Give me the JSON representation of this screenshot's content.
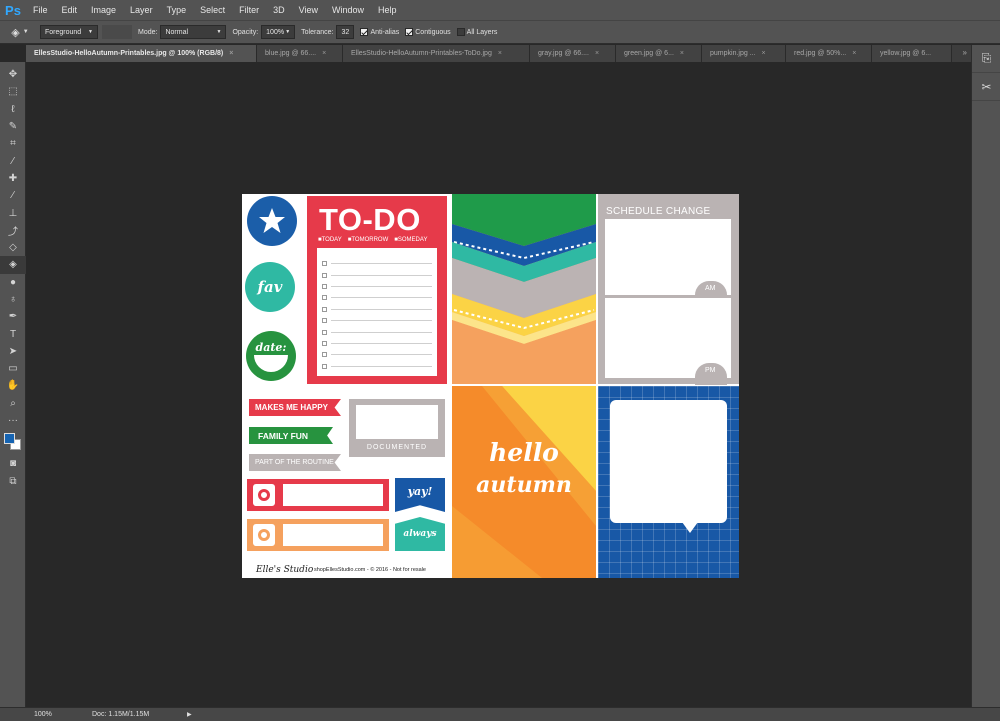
{
  "app": {
    "logo": "Ps"
  },
  "menu": [
    "File",
    "Edit",
    "Image",
    "Layer",
    "Type",
    "Select",
    "Filter",
    "3D",
    "View",
    "Window",
    "Help"
  ],
  "options": {
    "fill_source": "Foreground",
    "mode_label": "Mode:",
    "mode_value": "Normal",
    "opacity_label": "Opacity:",
    "opacity_value": "100%",
    "tolerance_label": "Tolerance:",
    "tolerance_value": "32",
    "anti_alias": "Anti-alias",
    "contiguous": "Contiguous",
    "all_layers": "All Layers"
  },
  "tabs": [
    {
      "label": "EllesStudio-HelloAutumn-Printables.jpg @ 100% (RGB/8)",
      "active": true
    },
    {
      "label": "blue.jpg @ 66....",
      "active": false
    },
    {
      "label": "EllesStudio-HelloAutumn-Printables-ToDo.jpg",
      "active": false
    },
    {
      "label": "gray.jpg @ 66....",
      "active": false
    },
    {
      "label": "green.jpg @ 6...",
      "active": false
    },
    {
      "label": "pumpkin.jpg ...",
      "active": false
    },
    {
      "label": "red.jpg @ 50%...",
      "active": false
    },
    {
      "label": "yellow.jpg @ 6...",
      "active": false
    }
  ],
  "tab_close": "×",
  "tab_more": "»",
  "tools": [
    {
      "icon": "move-icon",
      "glyph": "✥"
    },
    {
      "icon": "marquee-icon",
      "glyph": "⬚"
    },
    {
      "icon": "lasso-icon",
      "glyph": "ℓ"
    },
    {
      "icon": "quick-select-icon",
      "glyph": "✎"
    },
    {
      "icon": "crop-icon",
      "glyph": "⌗"
    },
    {
      "icon": "eyedropper-icon",
      "glyph": "⁄"
    },
    {
      "icon": "healing-icon",
      "glyph": "✚"
    },
    {
      "icon": "brush-icon",
      "glyph": "∕"
    },
    {
      "icon": "stamp-icon",
      "glyph": "⊥"
    },
    {
      "icon": "history-brush-icon",
      "glyph": "⤴"
    },
    {
      "icon": "eraser-icon",
      "glyph": "◇"
    },
    {
      "icon": "paint-bucket-icon",
      "glyph": "◈"
    },
    {
      "icon": "blur-icon",
      "glyph": "●"
    },
    {
      "icon": "dodge-icon",
      "glyph": "♁"
    },
    {
      "icon": "pen-icon",
      "glyph": "✒"
    },
    {
      "icon": "type-icon",
      "glyph": "T"
    },
    {
      "icon": "path-select-icon",
      "glyph": "➤"
    },
    {
      "icon": "rectangle-icon",
      "glyph": "▭"
    },
    {
      "icon": "hand-icon",
      "glyph": "✋"
    },
    {
      "icon": "zoom-icon",
      "glyph": "⌕"
    },
    {
      "icon": "more-tools-icon",
      "glyph": "···"
    }
  ],
  "colors": {
    "foreground": "#1664b2",
    "background": "#ffffff"
  },
  "status": {
    "zoom": "100%",
    "doc": "Doc: 1.15M/1.15M",
    "arrow": "▶"
  },
  "canvas": {
    "todo_title": "TO-DO",
    "todo_options": [
      "■TODAY",
      "■TOMORROW",
      "■SOMEDAY"
    ],
    "circle_fav": "fav",
    "circle_date": "date:",
    "schedule_title": "SCHEDULE CHANGE",
    "am": "AM",
    "pm": "PM",
    "banner_happy": "MAKES ME HAPPY",
    "banner_family": "FAMILY FUN",
    "banner_routine": "PART OF THE ROUTINE",
    "documented": "DOCUMENTED",
    "yay": "yay!",
    "always": "always",
    "hello": "hello",
    "autumn": "autumn",
    "footer_brand": "Elle's Studio",
    "footer_text": "shopEllesStudio.com - © 2016 - Not for resale"
  }
}
